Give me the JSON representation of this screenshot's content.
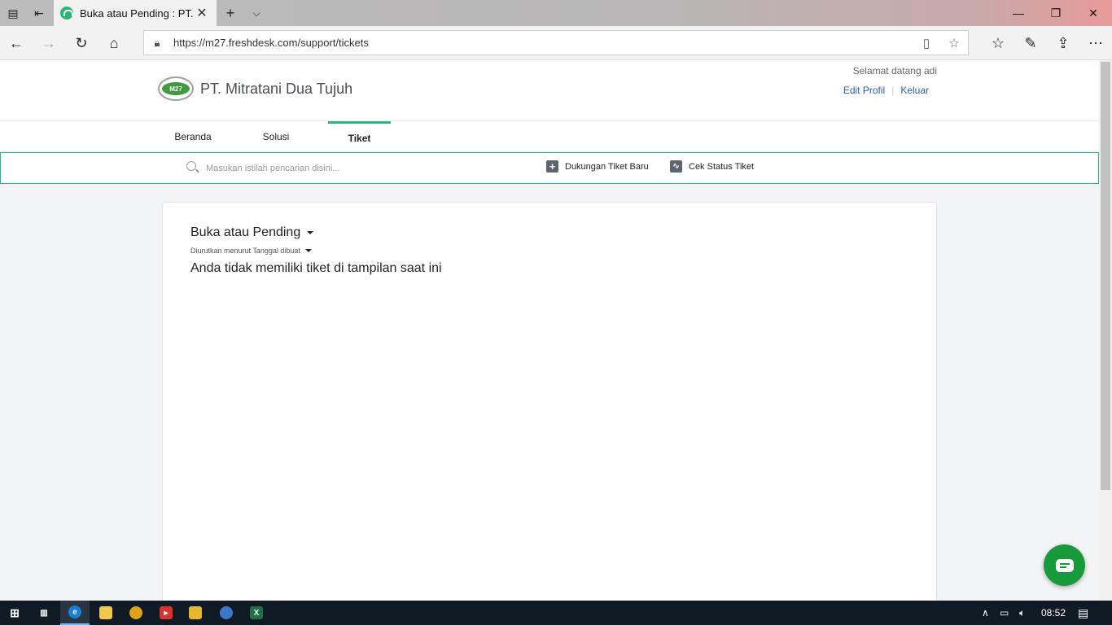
{
  "browser": {
    "tab_title": "Buka atau Pending : PT.",
    "url": "https://m27.freshdesk.com/support/tickets"
  },
  "header": {
    "company": "PT. Mitratani Dua Tujuh",
    "logo_text": "M27",
    "welcome": "Selamat datang adi",
    "edit_profile": "Edit Profil",
    "logout": "Keluar"
  },
  "nav": {
    "tabs": [
      {
        "label": "Beranda"
      },
      {
        "label": "Solusi"
      },
      {
        "label": "Tiket",
        "active": true
      }
    ]
  },
  "search": {
    "placeholder": "Masukan istilah pencarian disini...",
    "new_ticket": "Dukungan Tiket Baru",
    "check_status": "Cek Status Tiket"
  },
  "tickets": {
    "filter_label": "Buka atau Pending",
    "sort_label": "Diurutkan menurut Tanggal dibuat",
    "empty_message": "Anda tidak memiliki tiket di tampilan saat ini"
  },
  "taskbar": {
    "time": "08:52"
  },
  "colors": {
    "accent": "#2ab489",
    "link": "#2b60b5",
    "chat_button": "#179b3a",
    "taskbar": "#101a24"
  }
}
